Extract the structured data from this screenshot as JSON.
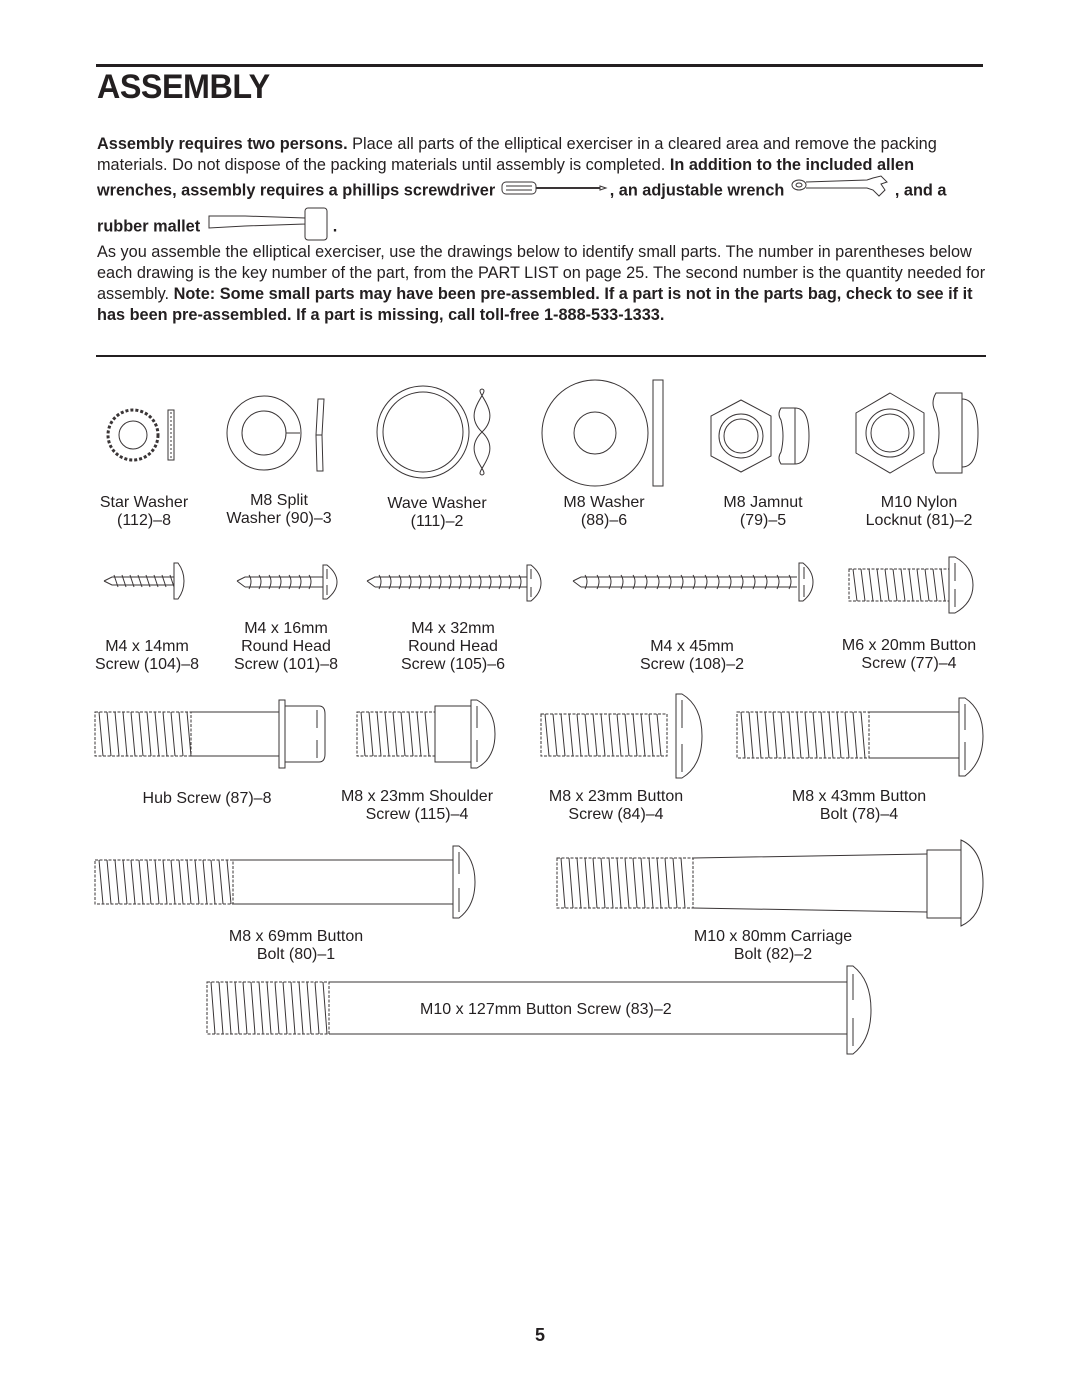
{
  "header": {
    "title": "ASSEMBLY"
  },
  "intro": {
    "bold1": "Assembly requires two persons.",
    "text1": " Place all parts of the elliptical exerciser in a cleared area and remove the packing materials. Do not dispose of the packing materials until assembly is completed. ",
    "bold2": "In addition to the included allen wrenches, assembly requires a phillips screwdriver",
    "bold3": ", an adjustable wrench",
    "bold4": ", and a rubber mallet",
    "end": ".",
    "tools": [
      "screwdriver-icon",
      "adjustable-wrench-icon",
      "rubber-mallet-icon"
    ]
  },
  "instructions": {
    "text": "As you assemble the elliptical exerciser, use the drawings below to identify small parts. The number in parentheses below each drawing is the key number of the part, from the PART LIST on page 25. The second number is the quantity needed for assembly. ",
    "bold": "Note: Some small parts may have been pre-assembled. If a part is not in the parts bag, check to see if it has been pre-assembled. If a part is missing, call toll-free 1-888-533-1333."
  },
  "parts": {
    "star_washer": [
      "Star Washer",
      "(112)–8"
    ],
    "split_washer": [
      "M8 Split",
      "Washer (90)–3"
    ],
    "wave_washer": [
      "Wave Washer",
      "(111)–2"
    ],
    "m8_washer": [
      "M8 Washer",
      "(88)–6"
    ],
    "jamnut": [
      "M8 Jamnut",
      "(79)–5"
    ],
    "nylon_locknut": [
      "M10 Nylon",
      "Locknut (81)–2"
    ],
    "screw_104": [
      "M4 x 14mm",
      "Screw (104)–8"
    ],
    "screw_101": [
      "M4 x 16mm",
      "Round Head",
      "Screw (101)–8"
    ],
    "screw_105": [
      "M4 x 32mm",
      "Round Head",
      "Screw (105)–6"
    ],
    "screw_108": [
      "M4 x 45mm",
      "Screw (108)–2"
    ],
    "screw_77": [
      "M6 x 20mm Button",
      "Screw (77)–4"
    ],
    "hub_screw": [
      "Hub Screw (87)–8"
    ],
    "shoulder_screw": [
      "M8 x 23mm Shoulder",
      "Screw (115)–4"
    ],
    "button_screw_84": [
      "M8 x 23mm Button",
      "Screw (84)–4"
    ],
    "button_bolt_78": [
      "M8 x 43mm Button",
      "Bolt (78)–4"
    ],
    "button_bolt_80": [
      "M8 x 69mm Button",
      "Bolt (80)–1"
    ],
    "carriage_bolt_82": [
      "M10 x 80mm Carriage",
      "Bolt (82)–2"
    ],
    "button_screw_83": "M10 x 127mm Button Screw (83)–2"
  },
  "footer": {
    "page_number": "5"
  }
}
